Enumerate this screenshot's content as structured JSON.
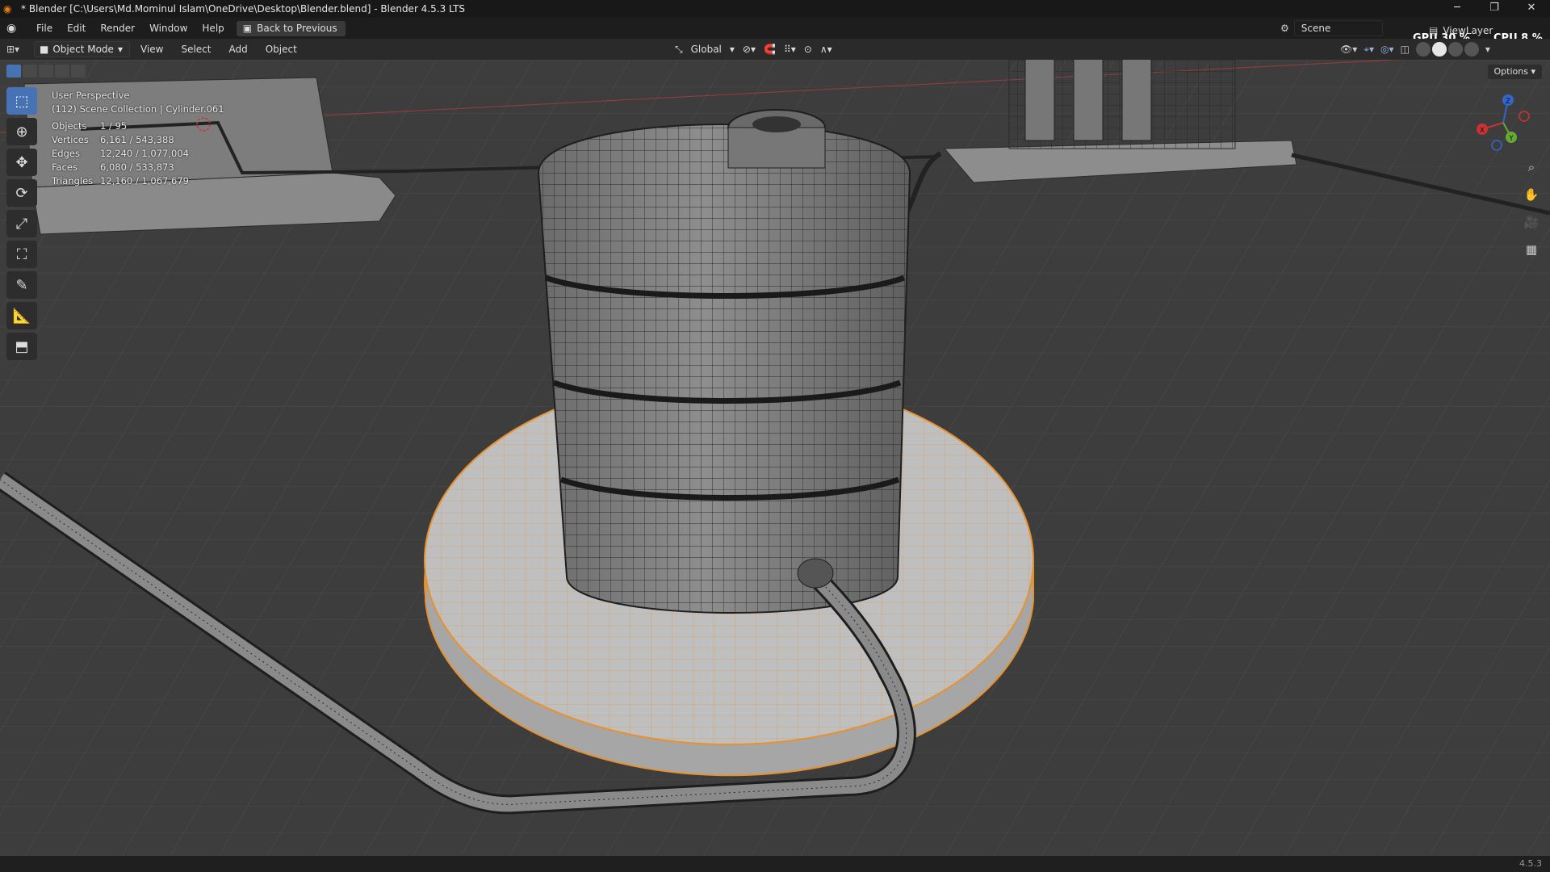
{
  "titlebar": {
    "title": "* Blender [C:\\Users\\Md.Mominul Islam\\OneDrive\\Desktop\\Blender.blend] - Blender 4.5.3 LTS",
    "min": "─",
    "max": "❐",
    "close": "✕"
  },
  "menubar": {
    "items": [
      "File",
      "Edit",
      "Render",
      "Window",
      "Help"
    ],
    "back_label": "Back to Previous",
    "scene_label": "Scene",
    "viewlayer_label": "ViewLayer",
    "gpu_label": "GPU",
    "gpu_value": "30 %",
    "cpu_label": "CPU",
    "cpu_value": "8 %"
  },
  "header": {
    "mode_label": "Object Mode",
    "menu": [
      "View",
      "Select",
      "Add",
      "Object"
    ],
    "orientation": "Global"
  },
  "viewport": {
    "perspective": "User Perspective",
    "collection": "(112) Scene Collection | Cylinder.061",
    "stats": [
      {
        "label": "Objects",
        "value": "1 / 95"
      },
      {
        "label": "Vertices",
        "value": "6,161 / 543,388"
      },
      {
        "label": "Edges",
        "value": "12,240 / 1,077,004"
      },
      {
        "label": "Faces",
        "value": "6,080 / 533,873"
      },
      {
        "label": "Triangles",
        "value": "12,160 / 1,067,679"
      }
    ],
    "options_label": "Options",
    "gizmo": {
      "x": "X",
      "y": "Y",
      "z": "Z"
    }
  },
  "colors": {
    "selection": "#e8912d",
    "accent": "#4772b3",
    "background": "#3d3d3d"
  },
  "status": {
    "version": "4.5.3"
  }
}
